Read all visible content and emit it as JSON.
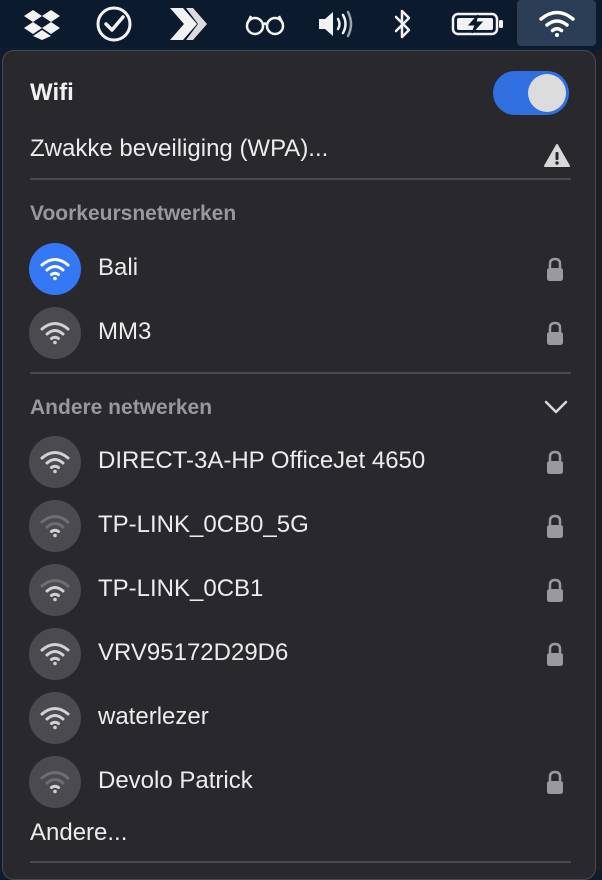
{
  "menubar": {
    "icons": [
      "dropbox-icon",
      "checkmark-circle-icon",
      "app-logo-icon",
      "glasses-icon",
      "volume-icon",
      "bluetooth-icon",
      "battery-charging-icon",
      "wifi-icon"
    ]
  },
  "wifi_menu": {
    "title": "Wifi",
    "toggle_on": true,
    "current_network_status": "Zwakke beveiliging (WPA)...",
    "preferred_section": "Voorkeursnetwerken",
    "preferred_networks": [
      {
        "name": "Bali",
        "connected": true,
        "locked": true,
        "signal": 3
      },
      {
        "name": "MM3",
        "connected": false,
        "locked": true,
        "signal": 3
      }
    ],
    "other_section": "Andere netwerken",
    "other_networks": [
      {
        "name": "DIRECT-3A-HP OfficeJet 4650",
        "locked": true,
        "signal": 3
      },
      {
        "name": "TP-LINK_0CB0_5G",
        "locked": true,
        "signal": 1
      },
      {
        "name": "TP-LINK_0CB1",
        "locked": true,
        "signal": 2
      },
      {
        "name": "VRV95172D29D6",
        "locked": true,
        "signal": 3
      },
      {
        "name": "waterlezer",
        "locked": false,
        "signal": 3
      },
      {
        "name": "Devolo Patrick",
        "locked": true,
        "signal": 1
      }
    ],
    "other_label": "Andere..."
  },
  "colors": {
    "accent": "#3478f6",
    "panel": "#29282c",
    "menubar": "#0b1a2c"
  }
}
